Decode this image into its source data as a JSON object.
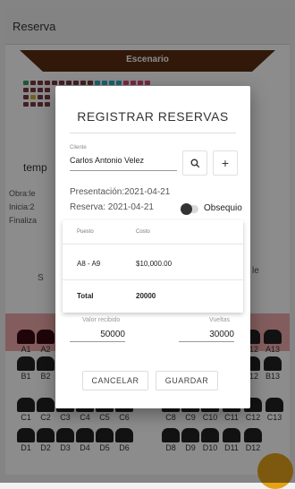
{
  "app": {
    "title": "Reserva"
  },
  "stage": {
    "label": "Escenario"
  },
  "background": {
    "temp_text": "temp",
    "obra_text": "Obra:le",
    "inicia_text": "Inicia:2",
    "finaliza_text": "Finaliza",
    "side_s": "S",
    "side_le": "le"
  },
  "seats": {
    "rows": [
      {
        "row": "A",
        "labels": [
          "A1",
          "A2",
          "A12",
          "A13"
        ]
      },
      {
        "row": "B",
        "labels": [
          "B1",
          "B2",
          "B12",
          "B13"
        ]
      },
      {
        "row": "C",
        "labels": [
          "C1",
          "C2",
          "C3",
          "C4",
          "C5",
          "C6",
          "C8",
          "C9",
          "C10",
          "C11",
          "C12",
          "C13"
        ]
      },
      {
        "row": "D",
        "labels": [
          "D1",
          "D2",
          "D3",
          "D4",
          "D5",
          "D6",
          "D8",
          "D9",
          "D10",
          "D11",
          "D12"
        ]
      }
    ]
  },
  "dialog": {
    "title": "REGISTRAR RESERVAS",
    "client": {
      "label": "Cliente",
      "value": "Carlos Antonio Velez"
    },
    "search_icon": "search-icon",
    "add_icon": "plus-icon",
    "presentacion": "Presentación:2021-04-21",
    "reserva": "Reserva: 2021-04-21",
    "obsequio_label": "Obsequio",
    "obsequio_on": false,
    "table": {
      "headers": [
        "Puesto",
        "Costo"
      ],
      "rows": [
        {
          "puesto": "A8 - A9",
          "costo": "$10,000.00"
        }
      ],
      "total_label": "Total",
      "total_value": "20000"
    },
    "valor_recibido": {
      "label": "Valor recibido",
      "value": "50000"
    },
    "vueltas": {
      "label": "Vueltas",
      "value": "30000"
    },
    "buttons": {
      "cancel": "CANCELAR",
      "save": "GUARDAR"
    }
  }
}
